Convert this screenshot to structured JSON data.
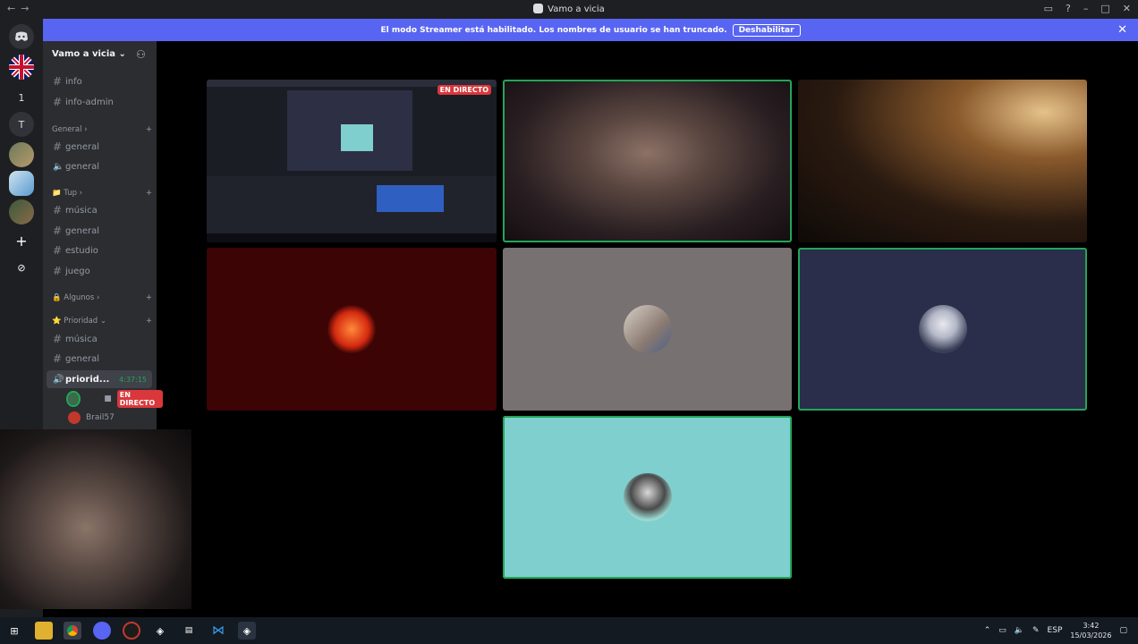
{
  "window": {
    "title": "Vamo a vicia",
    "nav_back": "←",
    "nav_fwd": "→"
  },
  "banner": {
    "text": "El modo Streamer está habilitado. Los nombres de usuario se han truncado.",
    "button": "Deshabilitar",
    "close": "✕"
  },
  "guilds": {
    "badge_count": "1",
    "letter_server": "T",
    "add": "+",
    "explore": "⊘"
  },
  "server": {
    "name": "Vamo a vicia",
    "top_channels": [
      "info",
      "info-admin"
    ],
    "categories": [
      {
        "name": "General",
        "channels": [
          {
            "type": "text",
            "name": "general"
          },
          {
            "type": "voice",
            "name": "general"
          }
        ]
      },
      {
        "name": "Tup",
        "channels": [
          {
            "type": "text",
            "name": "música"
          },
          {
            "type": "text",
            "name": "general"
          },
          {
            "type": "text",
            "name": "estudio"
          },
          {
            "type": "text",
            "name": "juego"
          }
        ]
      },
      {
        "name": "Algunos"
      },
      {
        "name": "Prioridad",
        "channels": [
          {
            "type": "text",
            "name": "música"
          },
          {
            "type": "text",
            "name": "general"
          }
        ]
      }
    ],
    "active_voice": {
      "name": "priorid...",
      "timer": "4:37:15"
    },
    "voice_users": [
      {
        "name": "",
        "live": "EN DIRECTO"
      },
      {
        "name": "Brail57"
      }
    ]
  },
  "stage": {
    "screen_live_tag": "EN DIRECTO"
  },
  "tray": {
    "lang": "ESP",
    "time": "3:42",
    "date": "15/03/2026"
  },
  "colors": {
    "blurple": "#5865f2",
    "speaking": "#23a55a",
    "live": "#da373c",
    "tile_gray": "#777171",
    "tile_navy": "#2a2e4a",
    "tile_teal": "#7fcfcf",
    "tile_red": "#3c0405"
  }
}
